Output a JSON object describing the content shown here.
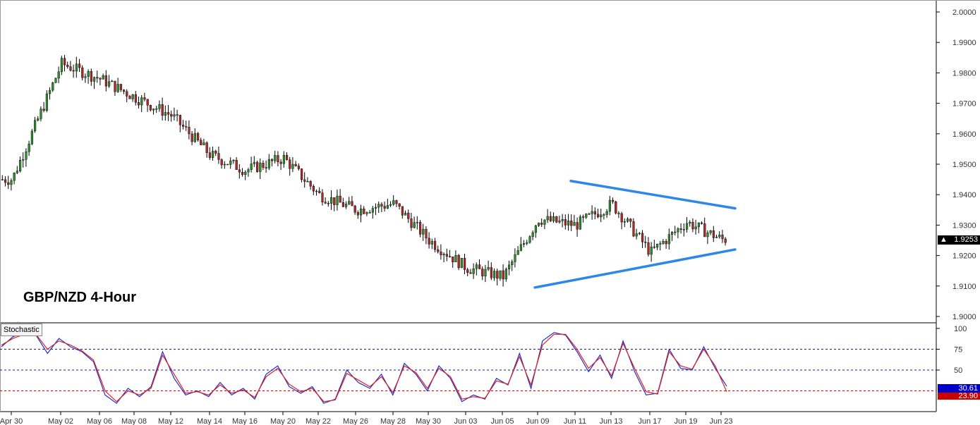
{
  "title": "GBP/NZD 4-Hour",
  "stochastic_label": "Stochastic",
  "current_price": "1.9253",
  "stoch_values": {
    "k": "30.61",
    "d": "23.90"
  },
  "colors": {
    "bull": "#2e8b2e",
    "bear": "#a52a2a",
    "trendline": "#2f86ea",
    "stoch_k": "#1f2fd0",
    "stoch_d": "#e02020",
    "level_line": "#1a1a8c",
    "mid_level_line": "#1a1a8c",
    "low_level_line": "#cc0000"
  },
  "chart_data": [
    {
      "type": "candlestick",
      "title": "GBP/NZD 4-Hour",
      "ylim": [
        1.9,
        2.0
      ],
      "y_ticks": [
        "2.0000",
        "1.9900",
        "1.9800",
        "1.9700",
        "1.9600",
        "1.9500",
        "1.9400",
        "1.9300",
        "1.9200",
        "1.9100",
        "1.9000"
      ],
      "x_ticks": [
        "Apr 30",
        "May 02",
        "May 06",
        "May 08",
        "May 12",
        "May 14",
        "May 16",
        "May 20",
        "May 22",
        "May 26",
        "May 28",
        "May 30",
        "Jun 03",
        "Jun 05",
        "Jun 09",
        "Jun 11",
        "Jun 13",
        "Jun 17",
        "Jun 19",
        "Jun 23"
      ],
      "close_path": [
        [
          "Apr 30",
          1.945
        ],
        [
          "May 02",
          1.983
        ],
        [
          "May 06",
          1.978
        ],
        [
          "May 08",
          1.972
        ],
        [
          "May 12",
          1.966
        ],
        [
          "May 14",
          1.953
        ],
        [
          "May 16",
          1.948
        ],
        [
          "May 20",
          1.952
        ],
        [
          "May 22",
          1.94
        ],
        [
          "May 26",
          1.935
        ],
        [
          "May 28",
          1.937
        ],
        [
          "May 30",
          1.925
        ],
        [
          "Jun 03",
          1.916
        ],
        [
          "Jun 05",
          1.913
        ],
        [
          "Jun 09",
          1.932
        ],
        [
          "Jun 11",
          1.93
        ],
        [
          "Jun 13",
          1.937
        ],
        [
          "Jun 17",
          1.921
        ],
        [
          "Jun 19",
          1.931
        ],
        [
          "Jun 23",
          1.9253
        ]
      ],
      "trendlines": [
        {
          "name": "upper",
          "from": [
            "Jun 10",
            1.9445
          ],
          "to": [
            "Jun 23",
            1.9355
          ]
        },
        {
          "name": "lower",
          "from": [
            "Jun 06",
            1.9095
          ],
          "to": [
            "Jun 23",
            1.922
          ]
        }
      ],
      "last_price": 1.9253,
      "grid": false
    },
    {
      "type": "line",
      "title": "Stochastic",
      "ylim": [
        0,
        100
      ],
      "y_ticks": [
        "100",
        "75",
        "50"
      ],
      "levels": [
        75,
        50,
        25
      ],
      "series": [
        {
          "name": "%K",
          "values": [
            78,
            90,
            95,
            92,
            70,
            88,
            78,
            72,
            60,
            20,
            10,
            28,
            18,
            30,
            72,
            40,
            20,
            25,
            18,
            35,
            20,
            28,
            15,
            45,
            55,
            30,
            22,
            30,
            10,
            15,
            50,
            35,
            28,
            45,
            20,
            58,
            45,
            25,
            55,
            40,
            12,
            20,
            15,
            40,
            32,
            70,
            28,
            85,
            95,
            92,
            72,
            48,
            68,
            40,
            85,
            48,
            20,
            22,
            75,
            52,
            50,
            78,
            52,
            30.61
          ]
        },
        {
          "name": "%D",
          "values": [
            80,
            88,
            93,
            93,
            75,
            85,
            80,
            73,
            62,
            25,
            12,
            25,
            20,
            28,
            68,
            45,
            22,
            24,
            20,
            32,
            22,
            26,
            17,
            42,
            52,
            33,
            24,
            28,
            12,
            14,
            46,
            38,
            30,
            42,
            23,
            55,
            47,
            28,
            52,
            42,
            15,
            18,
            16,
            37,
            33,
            66,
            32,
            80,
            93,
            93,
            75,
            52,
            65,
            43,
            82,
            52,
            24,
            21,
            72,
            55,
            51,
            75,
            55,
            23.9
          ]
        }
      ]
    }
  ]
}
